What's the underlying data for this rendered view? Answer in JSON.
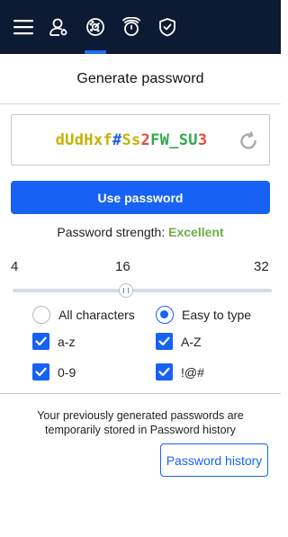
{
  "nav": {
    "items": [
      {
        "name": "menu",
        "icon": "hamburger-menu-icon"
      },
      {
        "name": "identities",
        "icon": "person-key-icon"
      },
      {
        "name": "password-generator",
        "icon": "password-dial-icon",
        "active": true
      },
      {
        "name": "security-alerts",
        "icon": "alarm-timer-icon"
      },
      {
        "name": "security",
        "icon": "shield-check-icon"
      }
    ],
    "active_color": "#1e6cf2",
    "background": "#0d1a33"
  },
  "header": {
    "title": "Generate password"
  },
  "generated_password": {
    "text": "dUdHxf#Ss2FW_SU3",
    "chars": [
      {
        "c": "d",
        "color": "#c4b400"
      },
      {
        "c": "U",
        "color": "#c4b400"
      },
      {
        "c": "d",
        "color": "#c4b400"
      },
      {
        "c": "H",
        "color": "#c4b400"
      },
      {
        "c": "x",
        "color": "#c4b400"
      },
      {
        "c": "f",
        "color": "#c4b400"
      },
      {
        "c": "#",
        "color": "#1f5fe0"
      },
      {
        "c": "S",
        "color": "#c4b400"
      },
      {
        "c": "s",
        "color": "#c4b400"
      },
      {
        "c": "2",
        "color": "#e84b3c"
      },
      {
        "c": "F",
        "color": "#2fa84f"
      },
      {
        "c": "W",
        "color": "#2fa84f"
      },
      {
        "c": "_",
        "color": "#2fa84f"
      },
      {
        "c": "S",
        "color": "#2fa84f"
      },
      {
        "c": "U",
        "color": "#2fa84f"
      },
      {
        "c": "3",
        "color": "#e84b3c"
      }
    ],
    "regenerate_icon": "refresh-icon"
  },
  "use_button": {
    "label": "Use password"
  },
  "strength": {
    "label": "Password strength:",
    "value": "Excellent",
    "color": "#6bb045"
  },
  "length": {
    "min": "4",
    "current": "16",
    "max": "32"
  },
  "options": {
    "all_characters": {
      "label": "All characters",
      "selected": false
    },
    "easy_to_type": {
      "label": "Easy to type",
      "selected": true
    },
    "lowercase": {
      "label": "a-z",
      "checked": true
    },
    "uppercase": {
      "label": "A-Z",
      "checked": true
    },
    "digits": {
      "label": "0-9",
      "checked": true
    },
    "symbols": {
      "label": "!@#",
      "checked": true
    }
  },
  "history_info": {
    "line1": "Your previously generated passwords are",
    "line2": "temporarily stored in Password history"
  },
  "history_button": {
    "label": "Password history"
  },
  "accent_color": "#1762f5"
}
